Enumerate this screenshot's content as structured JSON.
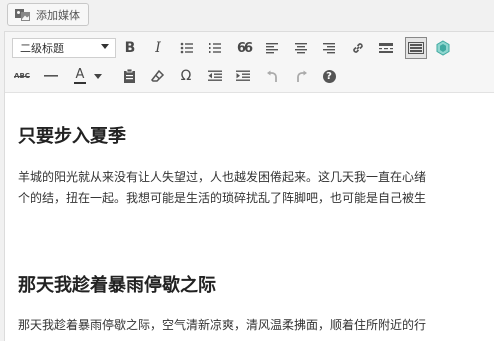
{
  "media_button": {
    "label": "添加媒体"
  },
  "toolbar": {
    "format_select": "二级标题",
    "row1_icons": [
      "bold-icon",
      "italic-icon",
      "bulleted-list-icon",
      "numbered-list-icon",
      "blockquote-icon",
      "align-left-icon",
      "align-center-icon",
      "align-right-icon",
      "link-icon",
      "read-more-icon",
      "toolbar-toggle-icon",
      "plugin-icon"
    ],
    "row2_icons": [
      "strikethrough-icon",
      "horizontal-line-icon",
      "text-color-icon",
      "paste-text-icon",
      "clear-formatting-icon",
      "special-character-icon",
      "outdent-icon",
      "indent-icon",
      "undo-icon",
      "redo-icon",
      "help-icon"
    ],
    "bold_glyph": "B",
    "italic_glyph": "I",
    "quote_glyph": "66",
    "strike_glyph": "ABC",
    "text_color_glyph": "A",
    "omega_glyph": "Ω",
    "help_glyph": "?"
  },
  "content": {
    "heading1": "只要步入夏季",
    "para1_line1": "羊城的阳光就从来没有让人失望过，人也越发困倦起来。这几天我一直在心绪",
    "para1_line2": "个的结，扭在一起。我想可能是生活的琐碎扰乱了阵脚吧，也可能是自己被生",
    "heading2": "那天我趁着暴雨停歇之际",
    "para2_line1": "那天我趁着暴雨停歇之际，空气清新凉爽，清风温柔拂面，顺着住所附近的行"
  },
  "colors": {
    "toolbar_bg": "#f6f6f6",
    "active_bg": "#e4e4e4",
    "plugin_icon": "#3fa9a0",
    "text_color_bar": "#333333"
  }
}
